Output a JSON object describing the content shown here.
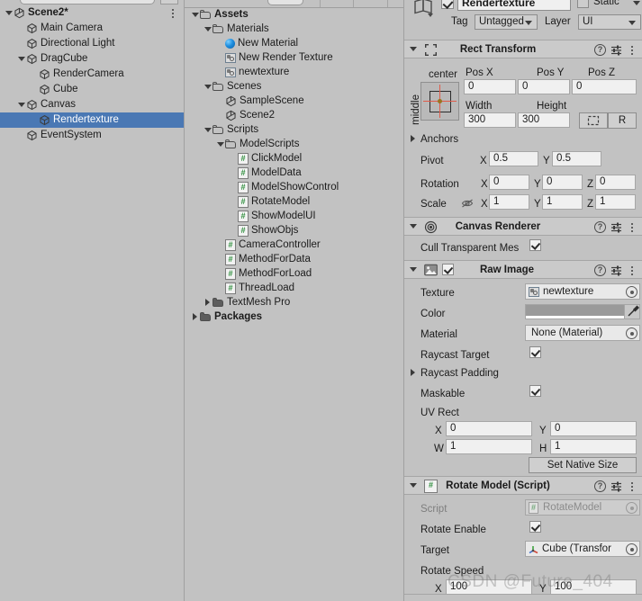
{
  "hierarchy": {
    "scene": {
      "label": "Scene2*",
      "icon": "unity-scene-icon"
    },
    "items": [
      {
        "label": "Main Camera",
        "depth": 1,
        "fold": "none",
        "icon": "gameobject-cube-icon",
        "selected": false
      },
      {
        "label": "Directional Light",
        "depth": 1,
        "fold": "none",
        "icon": "gameobject-cube-icon",
        "selected": false
      },
      {
        "label": "DragCube",
        "depth": 1,
        "fold": "down",
        "icon": "gameobject-cube-icon",
        "selected": false
      },
      {
        "label": "RenderCamera",
        "depth": 2,
        "fold": "none",
        "icon": "gameobject-cube-icon",
        "selected": false
      },
      {
        "label": "Cube",
        "depth": 2,
        "fold": "none",
        "icon": "gameobject-cube-icon",
        "selected": false
      },
      {
        "label": "Canvas",
        "depth": 1,
        "fold": "down",
        "icon": "gameobject-cube-icon",
        "selected": false
      },
      {
        "label": "Rendertexture",
        "depth": 2,
        "fold": "none",
        "icon": "gameobject-cube-icon",
        "selected": true
      },
      {
        "label": "EventSystem",
        "depth": 1,
        "fold": "none",
        "icon": "gameobject-cube-icon",
        "selected": false
      }
    ]
  },
  "project": {
    "items": [
      {
        "label": "Assets",
        "depth": 0,
        "fold": "down",
        "icon": "folder-open-icon",
        "bold": true
      },
      {
        "label": "Materials",
        "depth": 1,
        "fold": "down",
        "icon": "folder-open-icon",
        "bold": false
      },
      {
        "label": "New Material",
        "depth": 2,
        "fold": "none",
        "icon": "material-icon",
        "bold": false
      },
      {
        "label": "New Render Texture",
        "depth": 2,
        "fold": "none",
        "icon": "render-texture-icon",
        "bold": false
      },
      {
        "label": "newtexture",
        "depth": 2,
        "fold": "none",
        "icon": "render-texture-icon",
        "bold": false
      },
      {
        "label": "Scenes",
        "depth": 1,
        "fold": "down",
        "icon": "folder-open-icon",
        "bold": false
      },
      {
        "label": "SampleScene",
        "depth": 2,
        "fold": "none",
        "icon": "unity-scene-icon",
        "bold": false
      },
      {
        "label": "Scene2",
        "depth": 2,
        "fold": "none",
        "icon": "unity-scene-icon",
        "bold": false
      },
      {
        "label": "Scripts",
        "depth": 1,
        "fold": "down",
        "icon": "folder-open-icon",
        "bold": false
      },
      {
        "label": "ModelScripts",
        "depth": 2,
        "fold": "down",
        "icon": "folder-open-icon",
        "bold": false
      },
      {
        "label": "ClickModel",
        "depth": 3,
        "fold": "none",
        "icon": "csharp-script-icon",
        "bold": false
      },
      {
        "label": "ModelData",
        "depth": 3,
        "fold": "none",
        "icon": "csharp-script-icon",
        "bold": false
      },
      {
        "label": "ModelShowControl",
        "depth": 3,
        "fold": "none",
        "icon": "csharp-script-icon",
        "bold": false
      },
      {
        "label": "RotateModel",
        "depth": 3,
        "fold": "none",
        "icon": "csharp-script-icon",
        "bold": false
      },
      {
        "label": "ShowModelUI",
        "depth": 3,
        "fold": "none",
        "icon": "csharp-script-icon",
        "bold": false
      },
      {
        "label": "ShowObjs",
        "depth": 3,
        "fold": "none",
        "icon": "csharp-script-icon",
        "bold": false
      },
      {
        "label": "CameraController",
        "depth": 2,
        "fold": "none",
        "icon": "csharp-script-icon",
        "bold": false
      },
      {
        "label": "MethodForData",
        "depth": 2,
        "fold": "none",
        "icon": "csharp-script-icon",
        "bold": false
      },
      {
        "label": "MethodForLoad",
        "depth": 2,
        "fold": "none",
        "icon": "csharp-script-icon",
        "bold": false
      },
      {
        "label": "ThreadLoad",
        "depth": 2,
        "fold": "none",
        "icon": "csharp-script-icon",
        "bold": false
      },
      {
        "label": "TextMesh Pro",
        "depth": 1,
        "fold": "right",
        "icon": "folder-closed-icon",
        "bold": false
      },
      {
        "label": "Packages",
        "depth": 0,
        "fold": "right",
        "icon": "folder-closed-icon",
        "bold": true
      }
    ]
  },
  "inspector": {
    "object_name": "Rendertexture",
    "object_enabled": true,
    "static_label": "Static",
    "static_checked": false,
    "tag_label": "Tag",
    "tag_value": "Untagged",
    "layer_label": "Layer",
    "layer_value": "UI",
    "rect_transform": {
      "title": "Rect Transform",
      "anchor_preset_h": "center",
      "anchor_preset_v": "middle",
      "pos_x_label": "Pos X",
      "pos_x": "0",
      "pos_y_label": "Pos Y",
      "pos_y": "0",
      "pos_z_label": "Pos Z",
      "pos_z": "0",
      "width_label": "Width",
      "width": "300",
      "height_label": "Height",
      "height": "300",
      "blueprint_label": "",
      "raw_label": "R",
      "anchors_label": "Anchors",
      "pivot_label": "Pivot",
      "pivot_x": "0.5",
      "pivot_y": "0.5",
      "rotation_label": "Rotation",
      "rot_x": "0",
      "rot_y": "0",
      "rot_z": "0",
      "scale_label": "Scale",
      "scale_x": "1",
      "scale_y": "1",
      "scale_z": "1",
      "axis_x": "X",
      "axis_y": "Y",
      "axis_z": "Z"
    },
    "canvas_renderer": {
      "title": "Canvas Renderer",
      "cull_label": "Cull Transparent Mes",
      "cull_checked": true
    },
    "raw_image": {
      "title": "Raw Image",
      "component_enabled": true,
      "texture_label": "Texture",
      "texture_value": "newtexture",
      "color_label": "Color",
      "color_value": "#9A9A9A",
      "material_label": "Material",
      "material_value": "None (Material)",
      "raycast_target_label": "Raycast Target",
      "raycast_target_checked": true,
      "raycast_padding_label": "Raycast Padding",
      "maskable_label": "Maskable",
      "maskable_checked": true,
      "uv_rect_label": "UV Rect",
      "uv_x_label": "X",
      "uv_x": "0",
      "uv_y_label": "Y",
      "uv_y": "0",
      "uv_w_label": "W",
      "uv_w": "1",
      "uv_h_label": "H",
      "uv_h": "1",
      "set_native_size_label": "Set Native Size"
    },
    "rotate_model": {
      "title": "Rotate Model (Script)",
      "script_label": "Script",
      "script_value": "RotateModel",
      "rotate_enable_label": "Rotate Enable",
      "rotate_enable_checked": true,
      "target_label": "Target",
      "target_value": "Cube (Transfor",
      "rotate_speed_label": "Rotate Speed",
      "speed_x_label": "X",
      "speed_x": "100",
      "speed_y_label": "Y",
      "speed_y": "100"
    }
  },
  "watermark": {
    "text": "CSDN @Future_404"
  },
  "colors": {
    "panel_bg": "#C2C2C2",
    "selection_blue": "#4A78B4",
    "field_bg": "#F0F0F0",
    "component_header": "#CACACA"
  }
}
